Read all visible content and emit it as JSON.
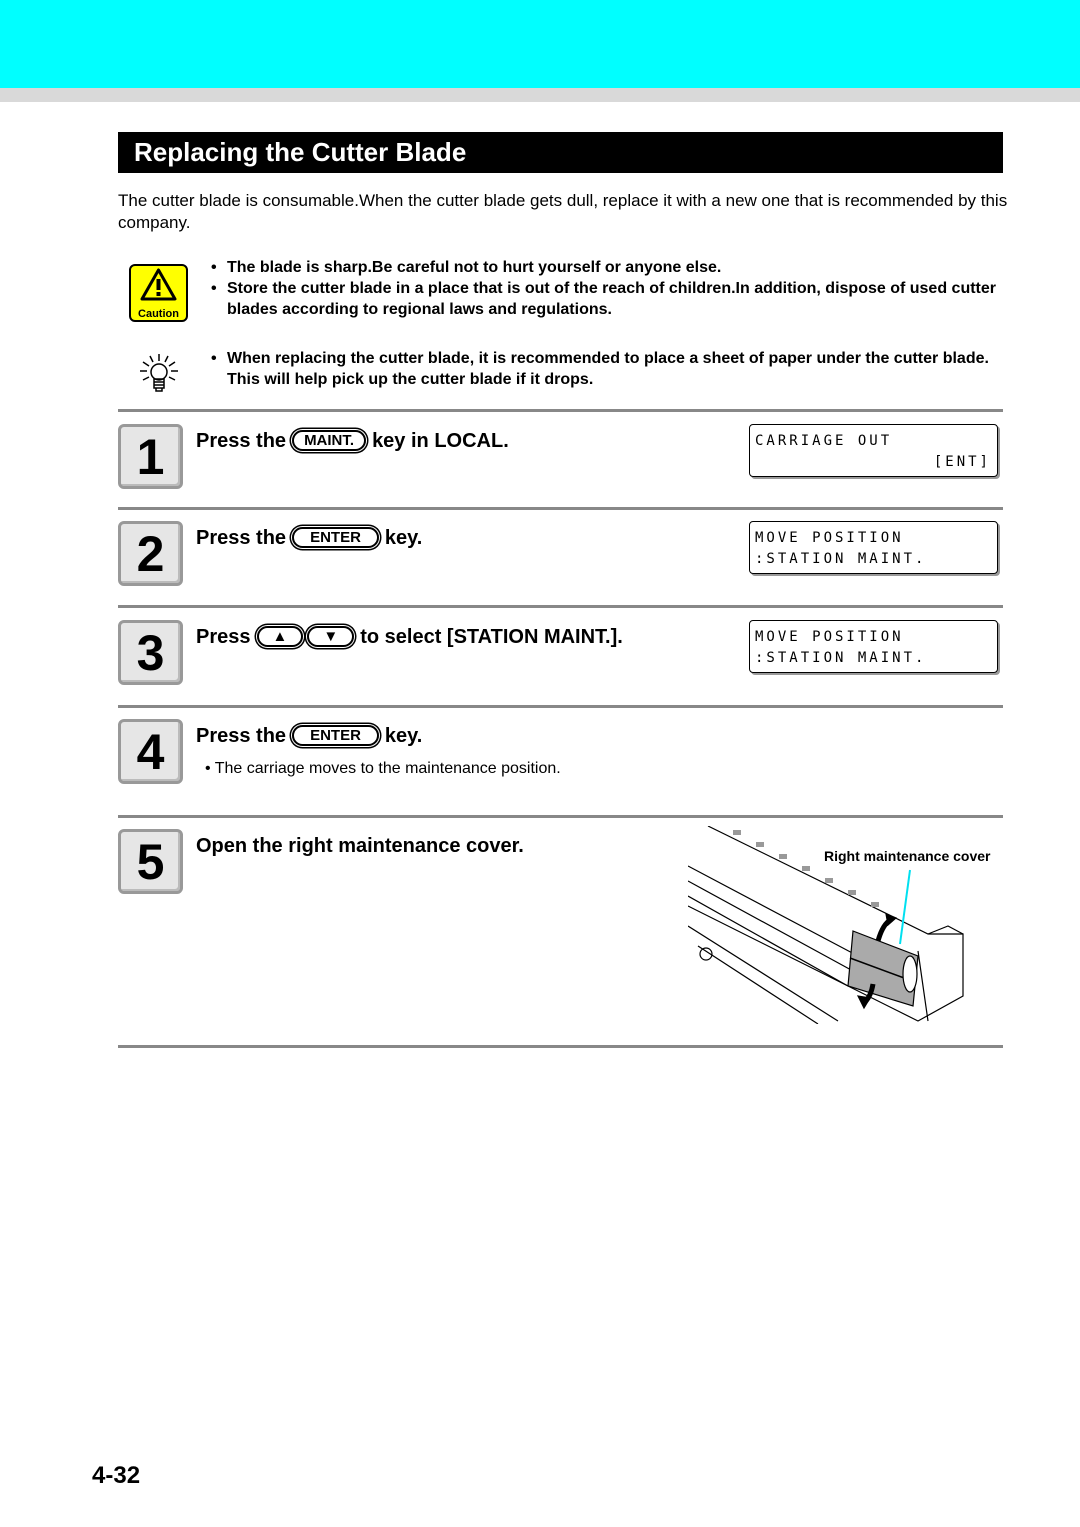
{
  "title": "Replacing the Cutter Blade",
  "intro": "The cutter blade is consumable.When the cutter blade gets dull, replace it with a new one that is recommended by this company.",
  "caution": {
    "icon": "caution-icon",
    "label": "Caution",
    "items": [
      "The blade is sharp.Be careful not to hurt yourself or anyone else.",
      "Store the cutter blade in a place that is out of the reach of children.In addition, dispose of used cutter blades according to regional laws and regulations."
    ]
  },
  "tip": {
    "icon": "lightbulb-icon",
    "items": [
      "When replacing the cutter blade, it is recommended to place a sheet of paper under the cutter blade. This will help pick up the cutter blade if it drops."
    ]
  },
  "steps": [
    {
      "number": "1",
      "pre": "Press the",
      "key": "MAINT.",
      "post": "key in LOCAL.",
      "lcd": [
        "CARRIAGE OUT",
        "[ENT]"
      ]
    },
    {
      "number": "2",
      "pre": "Press the",
      "key": "ENTER",
      "post": "key.",
      "lcd": [
        "MOVE POSITION",
        ":STATION MAINT."
      ]
    },
    {
      "number": "3",
      "pre": "Press",
      "key_up": "▲",
      "key_down": "▼",
      "post": "to select [STATION MAINT.].",
      "lcd": [
        "MOVE POSITION",
        ":STATION MAINT."
      ]
    },
    {
      "number": "4",
      "pre": "Press the",
      "key": "ENTER",
      "post": "key.",
      "note": "• The carriage moves to the maintenance position."
    },
    {
      "number": "5",
      "text": "Open the right maintenance cover.",
      "figure_label": "Right maintenance cover"
    }
  ],
  "page_number": "4-32"
}
